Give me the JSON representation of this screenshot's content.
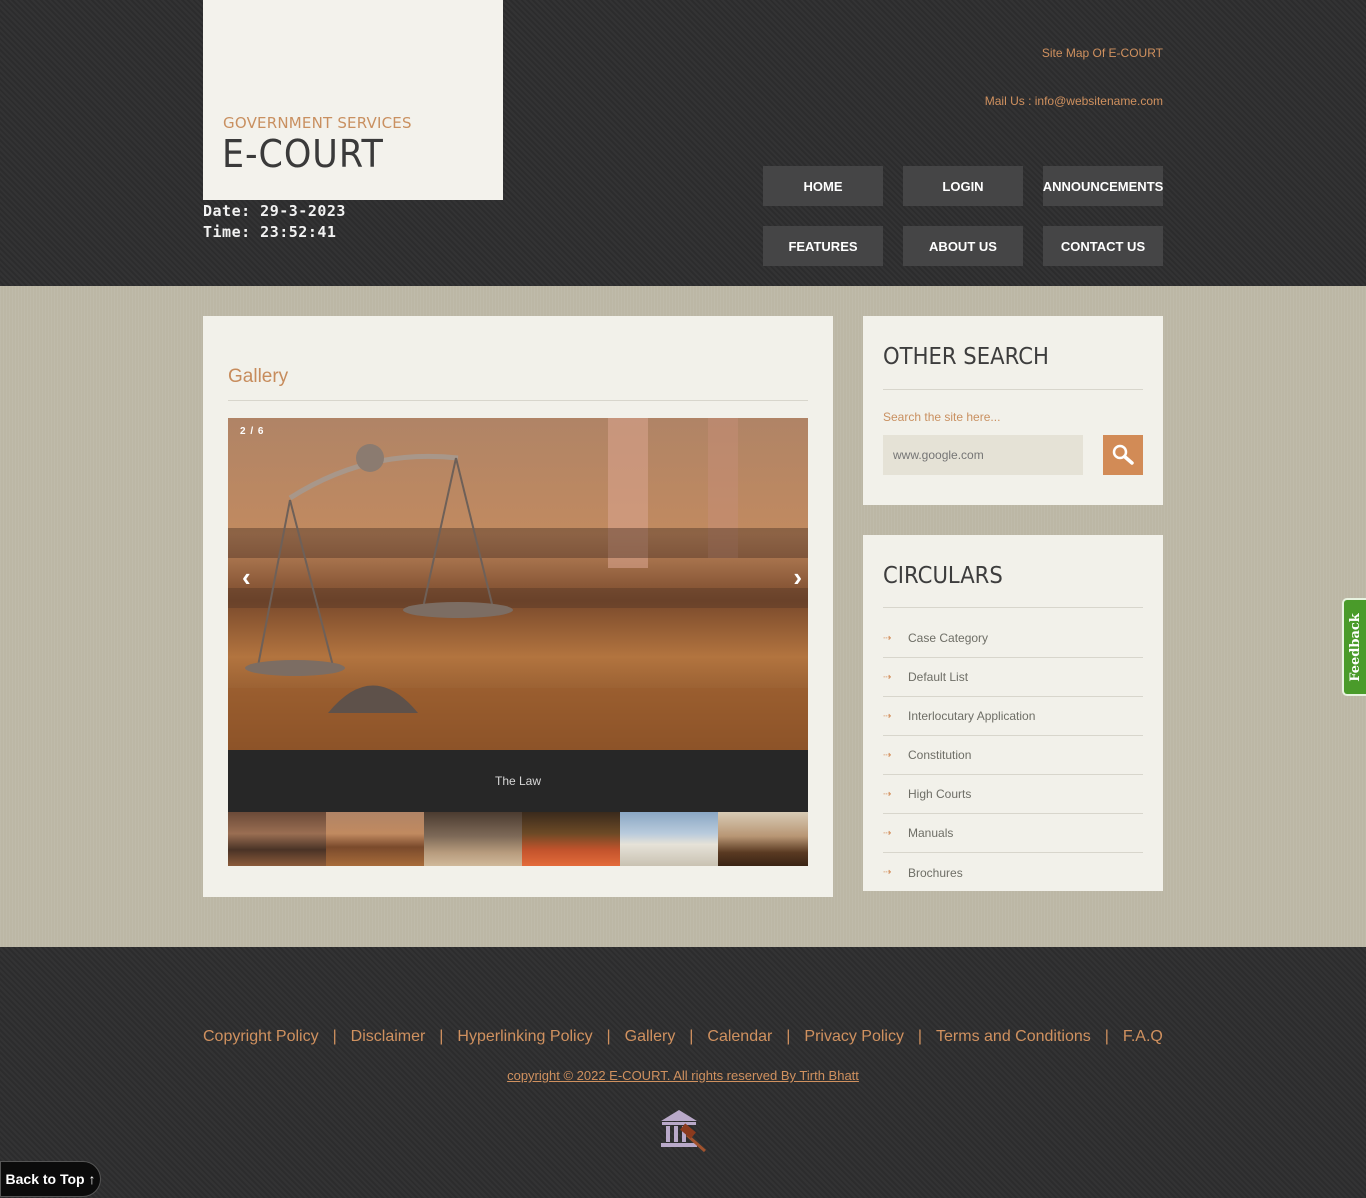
{
  "header": {
    "subtitle": "GOVERNMENT SERVICES",
    "title": "E-COURT",
    "date_line": "Date: 29-3-2023",
    "time_line": "Time: 23:52:41",
    "sitemap_label": "Site Map Of E-COURT",
    "mail_label": "Mail Us :",
    "mail_value": "info@websitename.com"
  },
  "nav": {
    "items": [
      {
        "label": "HOME"
      },
      {
        "label": "LOGIN"
      },
      {
        "label": "ANNOUNCEMENTS"
      },
      {
        "label": "FEATURES"
      },
      {
        "label": "ABOUT US"
      },
      {
        "label": "CONTACT US"
      }
    ]
  },
  "gallery": {
    "title": "Gallery",
    "counter": "2 / 6",
    "caption": "The Law",
    "prev_arrow": "‹",
    "next_arrow": "›",
    "thumbnails": [
      "courtroom",
      "scales",
      "courtroom-interior",
      "gavel-red",
      "supreme-court",
      "gavel-book"
    ]
  },
  "search": {
    "heading": "OTHER SEARCH",
    "label": "Search the site here...",
    "placeholder": "www.google.com",
    "button_icon": "magnifier-icon"
  },
  "circulars": {
    "heading": "CIRCULARS",
    "items": [
      {
        "label": "Case Category"
      },
      {
        "label": "Default List"
      },
      {
        "label": "Interlocutary Application"
      },
      {
        "label": "Constitution"
      },
      {
        "label": "High Courts"
      },
      {
        "label": "Manuals"
      },
      {
        "label": "Brochures"
      }
    ]
  },
  "feedback": {
    "label": "Feedback",
    "color": "#4a9b2a"
  },
  "footer": {
    "links": [
      {
        "label": "Copyright Policy"
      },
      {
        "label": "Disclaimer"
      },
      {
        "label": "Hyperlinking Policy"
      },
      {
        "label": "Gallery"
      },
      {
        "label": "Calendar"
      },
      {
        "label": "Privacy Policy"
      },
      {
        "label": "Terms and Conditions"
      },
      {
        "label": "F.A.Q"
      }
    ],
    "separator": "|",
    "copyright": "copyright © 2022 E-COURT. All rights reserved By Tirth Bhatt",
    "back_to_top": "Back to Top ↑"
  },
  "colors": {
    "accent": "#d0915f",
    "header_bg": "#2e2e2f",
    "main_bg": "#bcb7a5",
    "panel_bg": "#f2f1ea",
    "nav_bg": "#454546"
  }
}
